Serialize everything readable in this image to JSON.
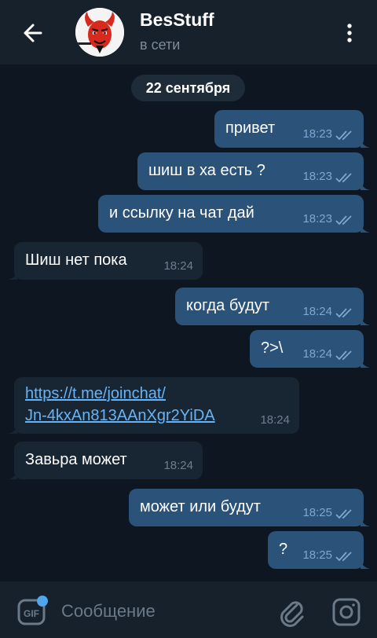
{
  "header": {
    "title": "BesStuff",
    "status": "в сети",
    "back_icon": "arrow-left-icon",
    "menu_icon": "more-vertical-icon"
  },
  "chat": {
    "date": "22 сентября",
    "messages": [
      {
        "dir": "out",
        "text": "привет",
        "time": "18:23",
        "read": true
      },
      {
        "dir": "out",
        "text": "шиш в ха есть ?",
        "time": "18:23",
        "read": true
      },
      {
        "dir": "out",
        "text": "и ссылку на чат дай",
        "time": "18:23",
        "read": true
      },
      {
        "dir": "in",
        "text": "Шиш нет пока",
        "time": "18:24"
      },
      {
        "dir": "out",
        "text": "когда будут",
        "time": "18:24",
        "read": true
      },
      {
        "dir": "out",
        "text": "?>\\",
        "time": "18:24",
        "read": true
      },
      {
        "dir": "in",
        "link_line1": "https://t.me/joinchat/",
        "link_line2": "Jn-4kxAn813AAnXgr2YiDA",
        "time": "18:24"
      },
      {
        "dir": "in",
        "text": "Завьра может",
        "time": "18:24"
      },
      {
        "dir": "out",
        "text": "может или будут",
        "time": "18:25",
        "read": true
      },
      {
        "dir": "out",
        "text": "?",
        "time": "18:25",
        "read": true
      }
    ]
  },
  "composer": {
    "placeholder": "Сообщение",
    "gif_label": "GIF",
    "attach_icon": "paperclip-icon",
    "camera_icon": "camera-icon"
  },
  "colors": {
    "background": "#0e1621",
    "header": "#17212b",
    "outgoing_bubble": "#2b5278",
    "incoming_bubble": "#182533",
    "link": "#6ab3f3",
    "accent": "#4fa6ea"
  }
}
